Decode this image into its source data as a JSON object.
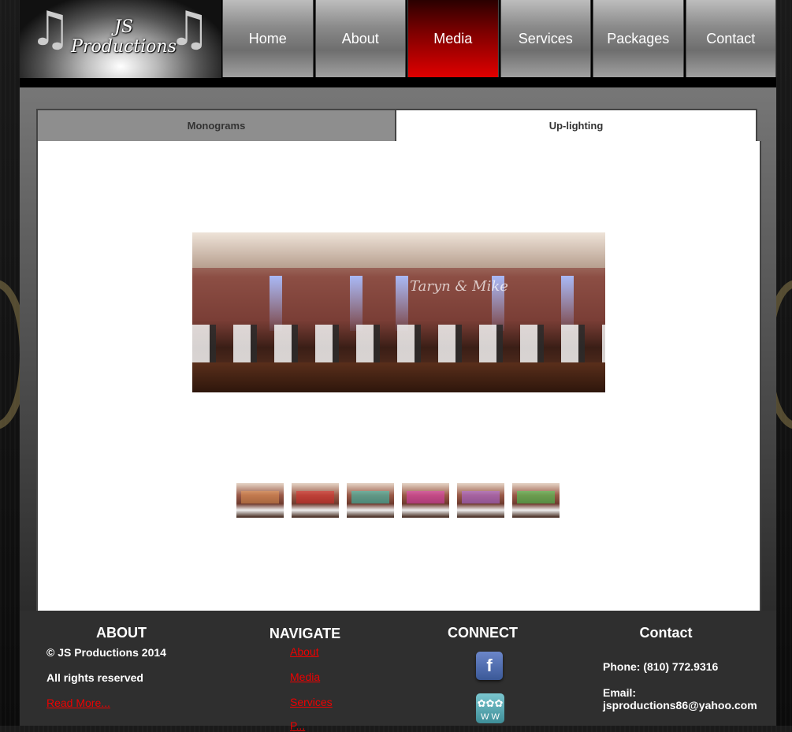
{
  "brand": {
    "logo_text": "JS Productions"
  },
  "nav": {
    "items": [
      {
        "label": "Home"
      },
      {
        "label": "About"
      },
      {
        "label": "Media"
      },
      {
        "label": "Services"
      },
      {
        "label": "Packages"
      },
      {
        "label": "Contact"
      }
    ],
    "active": "Media"
  },
  "media": {
    "tabs": [
      {
        "label": "Monograms"
      },
      {
        "label": "Up-lighting"
      }
    ],
    "active_tab": "Up-lighting",
    "photo_monogram": "Taryn & Mike",
    "thumbnail_count": 6
  },
  "footer": {
    "about": {
      "heading": "ABOUT",
      "copyright": "© JS Productions 2014",
      "rights": "All rights reserved",
      "read_more": "Read More..."
    },
    "navigate": {
      "heading": "NAVIGATE",
      "links": [
        "About",
        "Media",
        "Services",
        "P..."
      ]
    },
    "connect": {
      "heading": "CONNECT"
    },
    "contact": {
      "heading": "Contact",
      "phone": "Phone: (810) 772.9316",
      "email_label": "Email:",
      "email": "jsproductions86@yahoo.com"
    }
  },
  "colors": {
    "accent_red": "#e00000",
    "footer_bg": "#2f2f2f",
    "link": "#ee0000"
  }
}
